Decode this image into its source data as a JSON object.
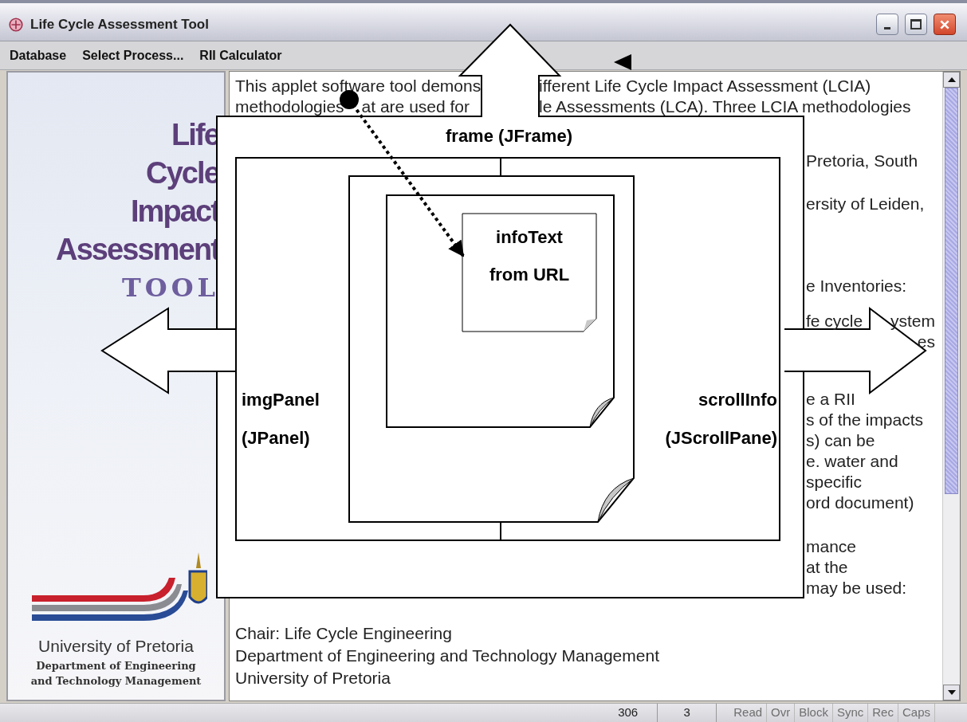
{
  "window": {
    "title": "Life Cycle Assessment Tool"
  },
  "menu": [
    "Database",
    "Select Process...",
    "RII Calculator"
  ],
  "img_panel": {
    "title_words": [
      "Life",
      "Cycle",
      "Impact",
      "Assessment"
    ],
    "tool_word": "TOOL",
    "university": "University of Pretoria",
    "department": [
      "Department of Engineering",
      "and Technology Management"
    ]
  },
  "info_text": {
    "top_lines": [
      {
        "left": [
          "This applet software tool demons"
        ],
        "right": "ifferent Life Cycle Impact Assessment (LCIA)"
      },
      {
        "left": [
          "methodologies",
          "at are used for"
        ],
        "right": "le Assessments (LCA). Three LCIA methodologies"
      }
    ],
    "right_paragraphs": [
      [
        {
          "start": "Pretoria, South"
        }
      ],
      [
        {
          "start": "ersity of Leiden,"
        }
      ],
      [
        {
          "start": "e Inventories:"
        }
      ],
      [
        {
          "start": "fe cycle",
          "end": "ystem"
        },
        {
          "end": "es"
        }
      ],
      [
        {
          "start": "e a RII"
        },
        {
          "start": "s of the impacts"
        },
        {
          "start": "s) can be"
        },
        {
          "start": "e. water and"
        },
        {
          "start": "specific"
        },
        {
          "start": "ord document)"
        }
      ],
      [
        {
          "start": "mance"
        },
        {
          "start": "at the"
        },
        {
          "start": "may be used:"
        }
      ]
    ],
    "bottom_lines": [
      "Chair: Life Cycle Engineering",
      "Department of Engineering and Technology Management",
      "University of Pretoria"
    ]
  },
  "diagram": {
    "frame_label": "frame (JFrame)",
    "panel_label": [
      "imgPanel",
      "(JPanel)"
    ],
    "scroll_label": [
      "scrollInfo",
      "(JScrollPane)"
    ],
    "note_label": [
      "infoText",
      "from URL"
    ]
  },
  "status_bar": {
    "fields": [
      "306",
      "3"
    ],
    "indicators": [
      {
        "label": "Read",
        "on": false
      },
      {
        "label": "Ovr",
        "on": false
      },
      {
        "label": "Block",
        "on": false
      },
      {
        "label": "Sync",
        "on": false
      },
      {
        "label": "Rec",
        "on": false
      },
      {
        "label": "Caps",
        "on": false
      }
    ]
  }
}
